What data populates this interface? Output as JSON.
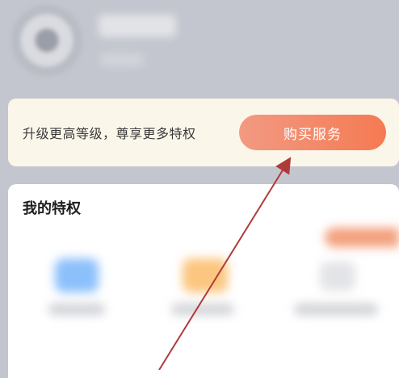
{
  "upgrade": {
    "text": "升级更高等级，尊享更多特权",
    "button_label": "购买服务"
  },
  "privileges": {
    "title": "我的特权"
  },
  "colors": {
    "button_start": "#f29a82",
    "button_end": "#f57a52",
    "annotation_arrow": "#b03a3a"
  }
}
